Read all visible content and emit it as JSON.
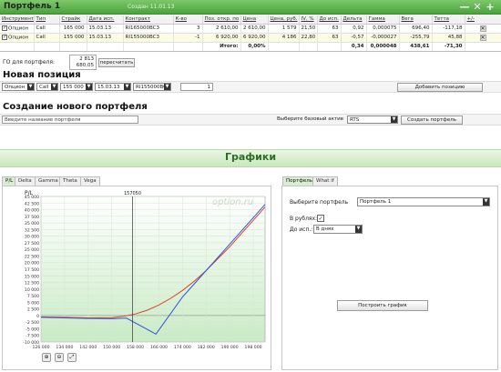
{
  "portfolio": {
    "title": "Портфель 1",
    "created": "Создан 11.01.13",
    "header_icons": [
      "minimize-icon",
      "close-icon",
      "add-icon",
      "add-icon"
    ]
  },
  "table": {
    "columns": [
      "Инструмент",
      "Тип",
      "Страйк",
      "Дата исп.",
      "Контракт",
      "К-во",
      "Поз. откр. по",
      "Цена",
      "Цена, руб.",
      "IV, %",
      "До исп.",
      "Дельта",
      "Гамма",
      "Вега",
      "Тетта",
      "+/-"
    ],
    "rows": [
      [
        "Опцион",
        "Call",
        "165 000",
        "15.03.13",
        "RI165000BC3",
        "3",
        "2 610,00",
        "2 610,00",
        "1 579",
        "21,50",
        "63",
        "0,92",
        "0,000075",
        "696,40",
        "-117,18"
      ],
      [
        "Опцион",
        "Call",
        "155 000",
        "15.03.13",
        "RI155000BC3",
        "-1",
        "6 920,00",
        "6 920,00",
        "4 186",
        "22,80",
        "63",
        "-0,57",
        "-0,000027",
        "-255,79",
        "45,88"
      ]
    ],
    "totals": {
      "label": "Итого:",
      "value": "0,00%",
      "delta": "0,34",
      "gamma": "0,000048",
      "vega": "438,61",
      "theta": "-71,30"
    }
  },
  "go": {
    "label": "ГО для портфеля:",
    "value1": "2 813",
    "value2": "680,05",
    "recalc_button": "пересчитать"
  },
  "new_position": {
    "title": "Новая позиция",
    "instrument": "Опцион",
    "type": "Call",
    "strike": "155 000",
    "date": "15.03.13",
    "contract": "RI155000BC3",
    "qty": "1",
    "add_button": "Добавить позицию"
  },
  "create_portfolio": {
    "title": "Создание нового портфеля",
    "name_placeholder": "Введите название портфеля",
    "base_label": "Выберите базовый актив",
    "base_value": "RTS",
    "create_button": "Создать портфель"
  },
  "charts": {
    "title": "Графики",
    "tabs": [
      "P/L",
      "Delta",
      "Gamma",
      "Theta",
      "Vega"
    ],
    "right_tabs": [
      "Портфель",
      "What if"
    ],
    "watermark": "option.ru",
    "crosshair_label": "157050",
    "ylabel": "P/L",
    "zoom_icons": [
      "zoom-in-icon",
      "zoom-out-icon",
      "zoom-reset-icon"
    ]
  },
  "settings": {
    "portfolio_label": "Выберите портфель",
    "portfolio_value": "Портфель 1",
    "rub_label": "В рублях:",
    "rub_checked": "✓",
    "expiry_label": "До исп.:",
    "expiry_value": "В днях",
    "build_button": "Построить график"
  },
  "chart_data": {
    "type": "line",
    "ylabel": "P/L",
    "ylim": [
      -10000,
      45000
    ],
    "xlim": [
      126000,
      202000
    ],
    "xticks": [
      "126 000",
      "134 000",
      "142 000",
      "150 000",
      "158 000",
      "166 000",
      "174 000",
      "182 000",
      "190 000",
      "198 000"
    ],
    "yticks": [
      "45 000",
      "42 500",
      "40 000",
      "37 500",
      "35 000",
      "32 500",
      "30 000",
      "27 500",
      "25 000",
      "22 500",
      "20 000",
      "17 500",
      "15 000",
      "12 500",
      "10 000",
      "7 500",
      "5 000",
      "2 500",
      "0",
      "-2 500",
      "-5 000",
      "-7 500",
      "-10 000"
    ],
    "crosshair_x": 157050,
    "series": [
      {
        "color": "#e0402a",
        "x": [
          126000,
          134000,
          142000,
          150000,
          154000,
          158000,
          162000,
          166000,
          170000,
          174000,
          178000,
          182000,
          186000,
          190000,
          194000,
          198000,
          202000
        ],
        "y": [
          -500,
          -700,
          -900,
          -800,
          -300,
          600,
          2000,
          4000,
          6500,
          9500,
          13000,
          17000,
          21500,
          26000,
          31000,
          36000,
          41000
        ]
      },
      {
        "color": "#2f56e0",
        "x": [
          126000,
          134000,
          142000,
          150000,
          155000,
          165000,
          174000,
          182000,
          190000,
          198000,
          202000
        ],
        "y": [
          -700,
          -900,
          -1100,
          -1200,
          -1000,
          -7000,
          7000,
          17000,
          27000,
          37000,
          42000
        ]
      }
    ]
  }
}
